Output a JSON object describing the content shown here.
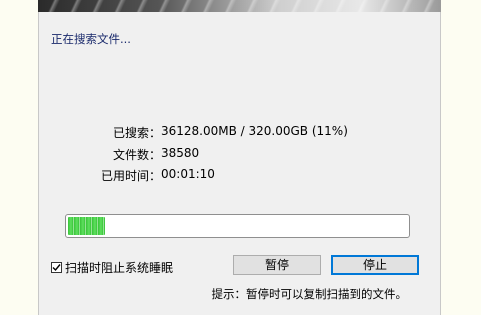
{
  "dialog": {
    "status": "正在搜索文件...",
    "stats": [
      {
        "label": "已搜索：",
        "value": "36128.00MB / 320.00GB (11%)"
      },
      {
        "label": "文件数：",
        "value": "38580"
      },
      {
        "label": "已用时间：",
        "value": "00:01:10"
      }
    ],
    "progress": {
      "percent": 11,
      "color": "#39c439"
    },
    "prevent_sleep": {
      "label": "扫描时阻止系统睡眠",
      "checked": true
    },
    "buttons": {
      "pause": "暂停",
      "stop": "停止"
    },
    "hint": "提示：暂停时可以复制扫描到的文件。"
  }
}
